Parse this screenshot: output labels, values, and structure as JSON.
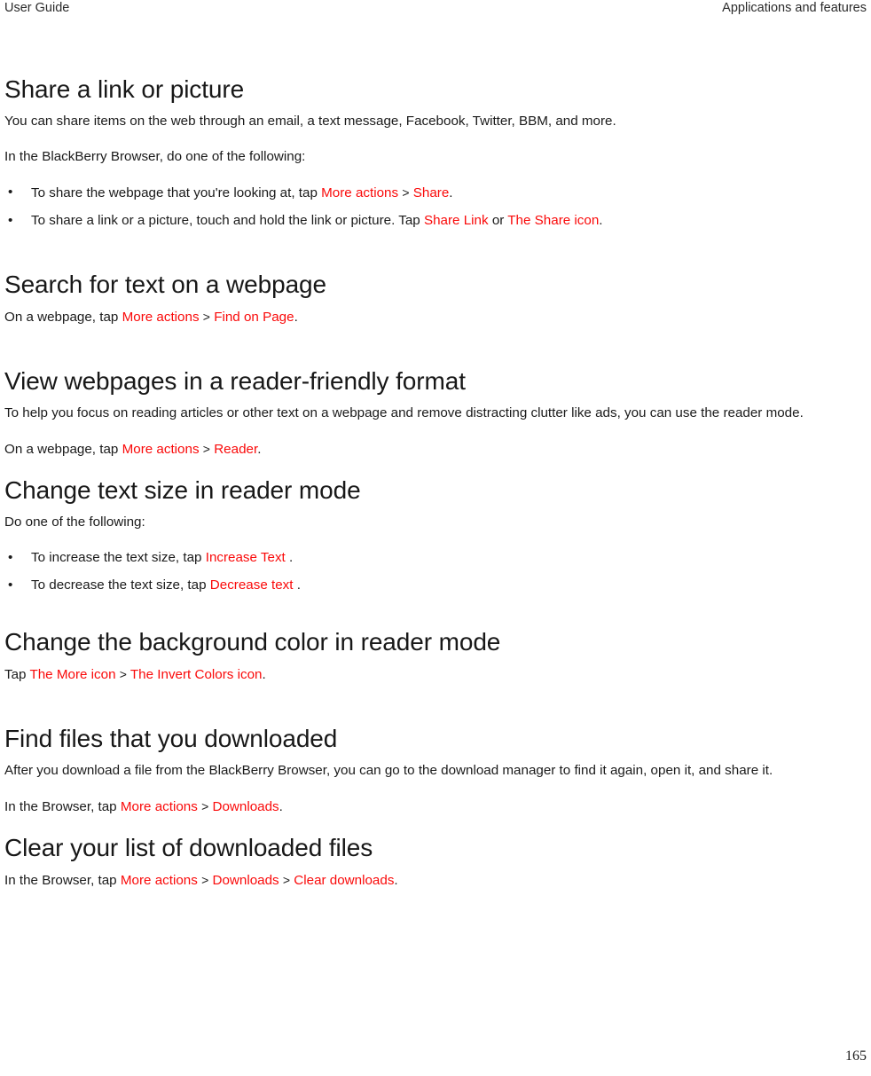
{
  "header": {
    "left": "User Guide",
    "right": "Applications and features"
  },
  "footer": {
    "page_number": "165"
  },
  "colors": {
    "link_red": "#fa0a0a",
    "text": "#1a1a1a",
    "background": "#ffffff"
  },
  "sections": [
    {
      "title": "Share a link or picture",
      "intro": "You can share items on the web through an email, a text message, Facebook, Twitter, BBM, and more.",
      "lead": "In the BlackBerry Browser, do one of the following:",
      "bullets": [
        {
          "pre": "To share the webpage that you're looking at, tap",
          "link1": "More actions",
          "sep1": ">",
          "link2": "Share",
          "post": "."
        },
        {
          "pre": "To share a link or a picture, touch and hold the link or picture. Tap",
          "link1": "Share Link",
          "mid": "or",
          "link2": "The Share icon",
          "post": "."
        }
      ]
    },
    {
      "title": "Search for text on a webpage",
      "step": {
        "pre": "On a webpage, tap",
        "link1": "More actions",
        "sep1": ">",
        "link2": "Find on Page",
        "post": "."
      }
    },
    {
      "title": "View webpages in a reader-friendly format",
      "intro": "To help you focus on reading articles or other text on a webpage and remove distracting clutter like ads, you can use the reader mode.",
      "step": {
        "pre": "On a webpage, tap",
        "link1": "More actions",
        "sep1": ">",
        "link2": "Reader",
        "post": "."
      }
    },
    {
      "title": "Change text size in reader mode",
      "lead": "Do one of the following:",
      "bullets": [
        {
          "pre": "To increase the text size, tap",
          "link1": "Increase Text",
          "post": "."
        },
        {
          "pre": "To decrease the text size, tap",
          "link1": "Decrease text",
          "post": "."
        }
      ]
    },
    {
      "title": "Change the background color in reader mode",
      "step": {
        "pre": "Tap",
        "link1": "The More icon",
        "sep1": ">",
        "link2": "The Invert Colors icon",
        "post": "."
      }
    },
    {
      "title": "Find files that you downloaded",
      "intro": "After you download a file from the BlackBerry Browser, you can go to the download manager to find it again, open it, and share it.",
      "step": {
        "pre": "In the Browser, tap",
        "link1": "More actions",
        "sep1": ">",
        "link2": "Downloads",
        "post": "."
      }
    },
    {
      "title": "Clear your list of downloaded files",
      "step": {
        "pre": "In the Browser, tap",
        "link1": "More actions",
        "sep1": ">",
        "link2": "Downloads",
        "sep2": ">",
        "link3": "Clear downloads",
        "post": "."
      }
    }
  ],
  "bullet_glyph": "•"
}
